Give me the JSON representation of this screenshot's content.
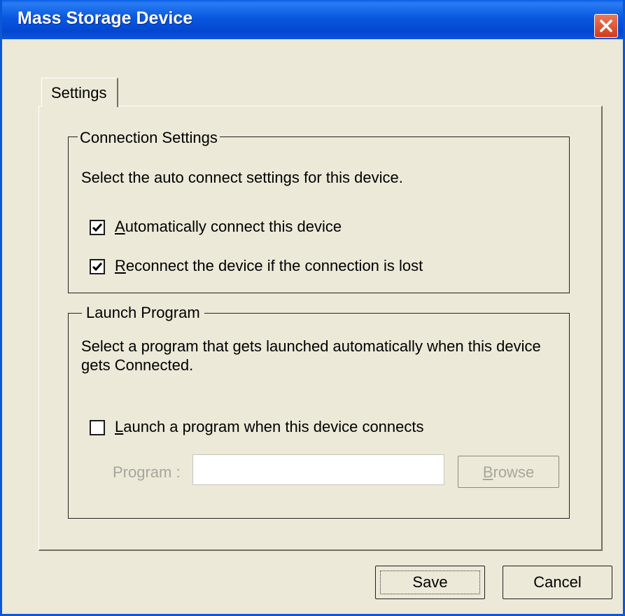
{
  "window": {
    "title": "Mass Storage Device"
  },
  "tabs": [
    {
      "label": "Settings"
    }
  ],
  "connection_settings": {
    "legend": "Connection Settings",
    "description": "Select the auto connect settings for this device.",
    "auto_connect": {
      "checked": true,
      "accel": "A",
      "label_rest": "utomatically connect this device"
    },
    "reconnect": {
      "checked": true,
      "accel": "R",
      "label_rest": "econnect the device if the connection is lost"
    }
  },
  "launch_program": {
    "legend": "Launch Program",
    "description_line1": "Select a program that gets launched automatically when this device",
    "description_line2": "gets Connected.",
    "launch_checkbox": {
      "checked": false,
      "accel": "L",
      "label_rest": "aunch a program when this device connects"
    },
    "program_label": "Program :",
    "program_value": "",
    "browse": {
      "accel": "B",
      "label_rest": "rowse"
    }
  },
  "buttons": {
    "save": "Save",
    "cancel": "Cancel"
  },
  "icons": {
    "close": "close-icon",
    "check": "checkmark-icon"
  },
  "colors": {
    "titlebar": "#0a57d8",
    "dialog_bg": "#ece9d8",
    "close": "#d43b1a",
    "disabled_text": "#a7a69d"
  }
}
